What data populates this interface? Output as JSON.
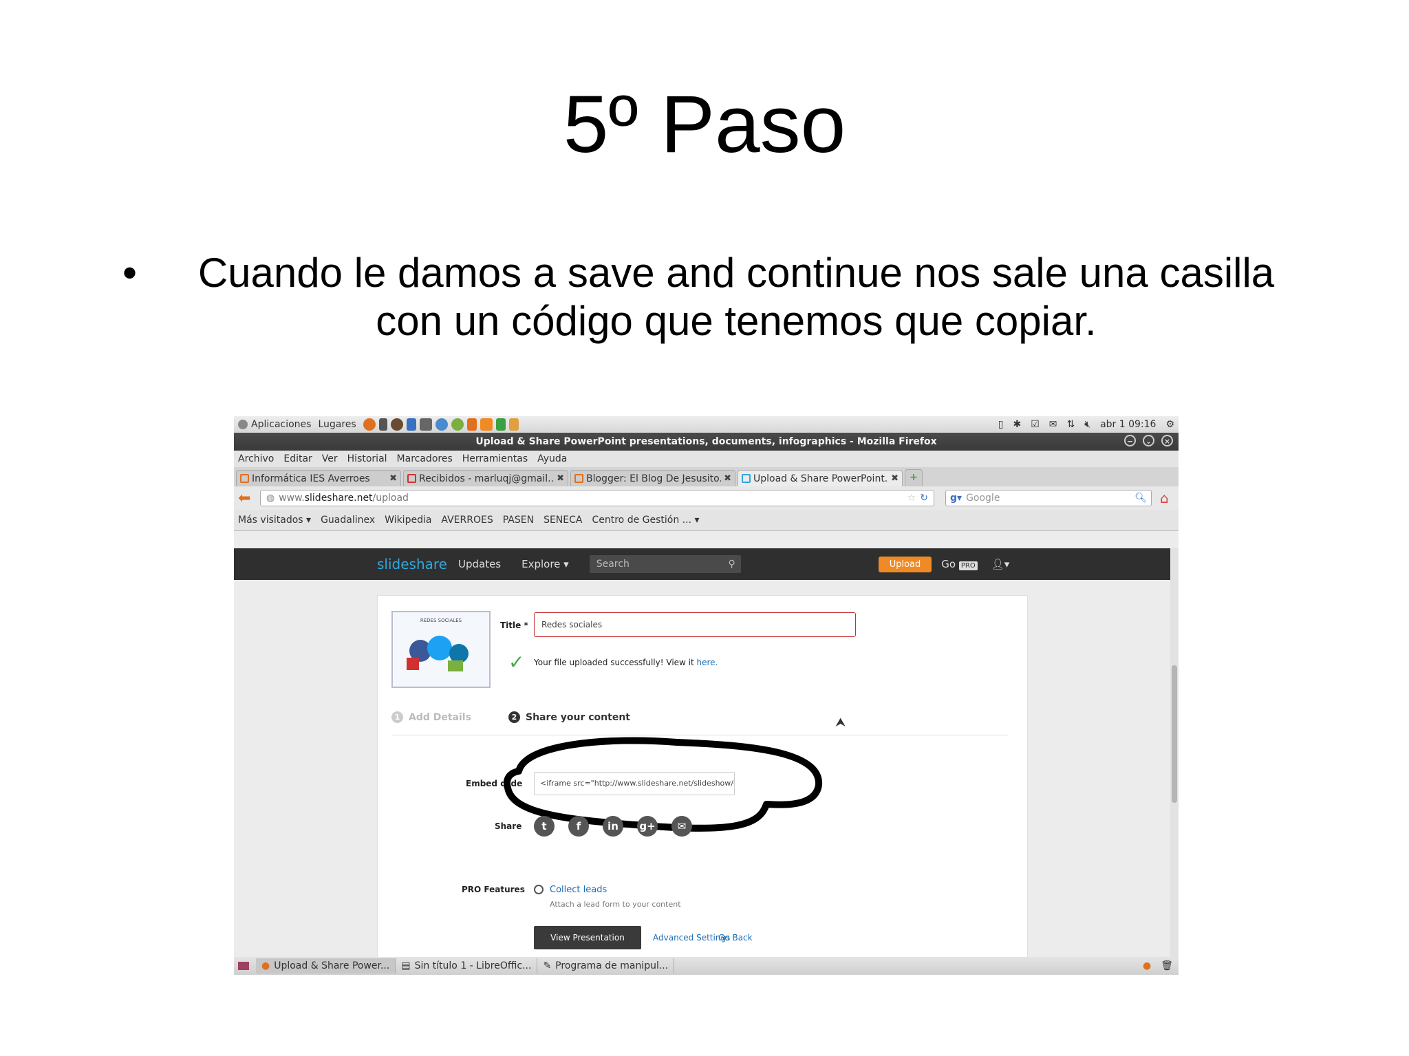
{
  "slide": {
    "title": "5º Paso",
    "bullet": "Cuando le damos a save and continue nos sale una casilla con un código que tenemos que copiar."
  },
  "desktop": {
    "apps": "Aplicaciones",
    "places": "Lugares",
    "clock": "abr 1 09:16"
  },
  "window": {
    "title": "Upload & Share PowerPoint presentations, documents, infographics - Mozilla Firefox"
  },
  "menu": [
    "Archivo",
    "Editar",
    "Ver",
    "Historial",
    "Marcadores",
    "Herramientas",
    "Ayuda"
  ],
  "tabs": [
    {
      "label": "Informática IES Averroes"
    },
    {
      "label": "Recibidos - marluqj@gmail...."
    },
    {
      "label": "Blogger: El Blog De Jesusito..."
    },
    {
      "label": "Upload & Share PowerPoint..."
    }
  ],
  "navbar": {
    "url_prefix": "www.",
    "url_domain": "slideshare.net",
    "url_path": "/upload",
    "search_placeholder": "Google"
  },
  "bookmarks": [
    "Más visitados ▾",
    "Guadalinex",
    "Wikipedia",
    "AVERROES",
    "PASEN",
    "SENECA",
    "Centro de Gestión ... ▾"
  ],
  "slideshare": {
    "logo": "slideshare",
    "updates": "Updates",
    "explore": "Explore ▾",
    "search": "Search",
    "upload": "Upload",
    "go": "Go",
    "pro": "PRO"
  },
  "upload_card": {
    "thumb_title": "REDES SOCIALES",
    "title_label": "Title *",
    "title_value": "Redes sociales",
    "success_msg": "Your file uploaded successfully! View it ",
    "success_link": "here.",
    "step1_num": "1",
    "step1": "Add Details",
    "step2_num": "2",
    "step2": "Share your content",
    "embed_label": "Embed code",
    "embed_value": "<iframe src=\"http://www.slideshare.net/slideshow/embed_code",
    "share_label": "Share",
    "pro_label": "PRO Features",
    "collect": "Collect leads",
    "attach": "Attach a lead form to your content",
    "view_btn": "View Presentation",
    "advanced": "Advanced Settings",
    "go_back": "Go Back"
  },
  "taskbar": [
    {
      "label": "Upload & Share Power..."
    },
    {
      "label": "Sin título 1 - LibreOffic..."
    },
    {
      "label": "Programa de manipul..."
    }
  ],
  "colors": {
    "accent_orange": "#f08a24",
    "link_blue": "#1a6db5",
    "error_red": "#c53030",
    "success_green": "#46a84a"
  }
}
